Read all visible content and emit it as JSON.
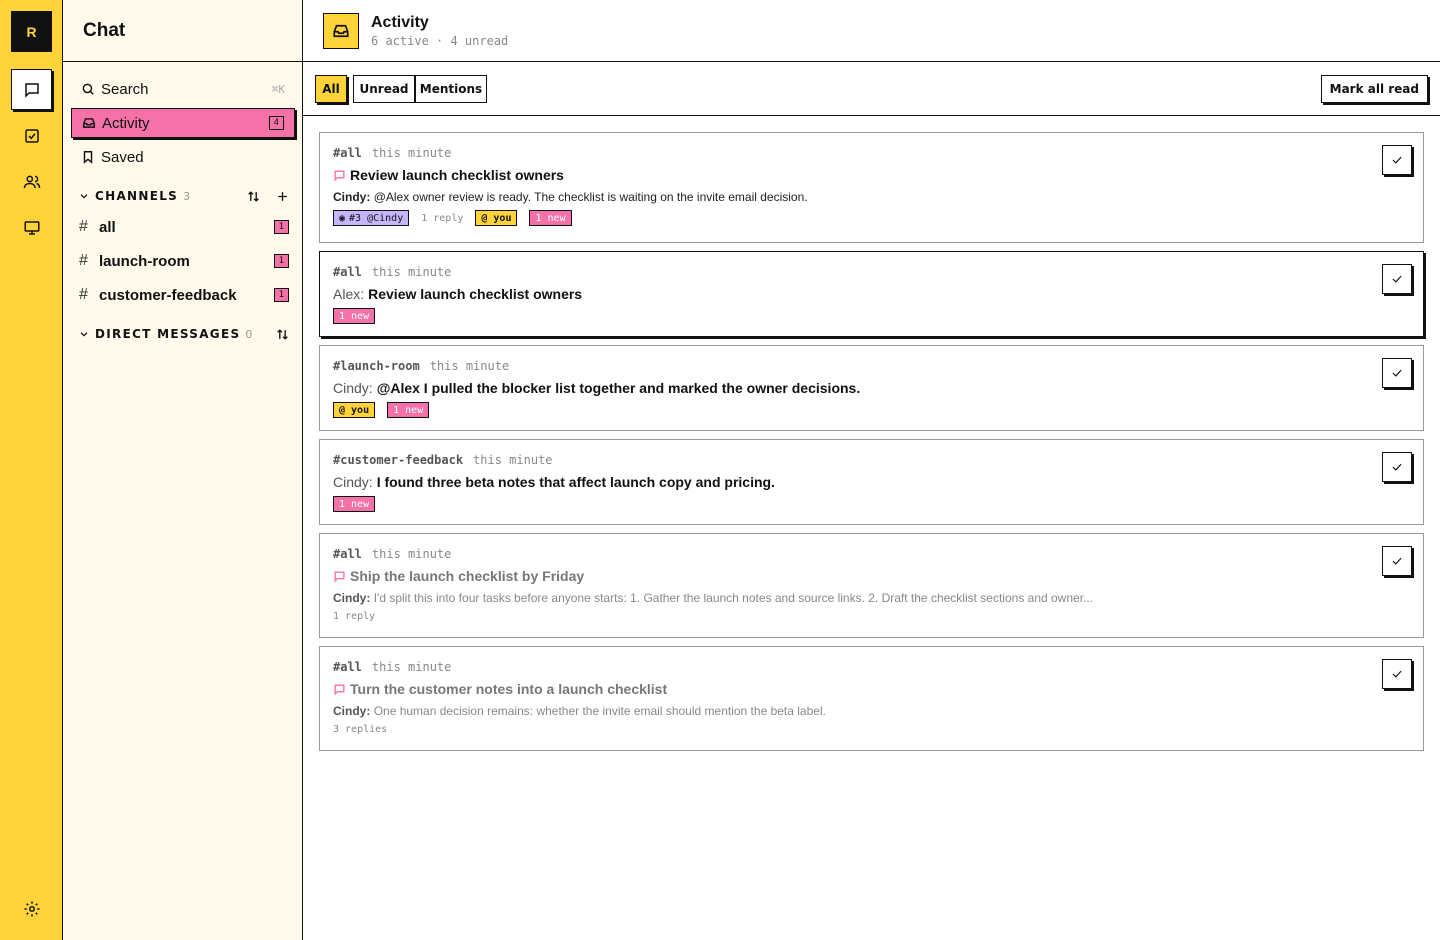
{
  "rail": {
    "logo": "R",
    "items": [
      {
        "icon": "chat-icon",
        "active": true
      },
      {
        "icon": "task-icon"
      },
      {
        "icon": "people-icon"
      },
      {
        "icon": "monitor-icon"
      }
    ],
    "settings_icon": "gear-icon"
  },
  "sidebar": {
    "title": "Chat",
    "search_label": "Search",
    "search_shortcut": "⌘K",
    "activity_label": "Activity",
    "activity_count": "4",
    "saved_label": "Saved",
    "channels_header": "CHANNELS",
    "channels_count": "3",
    "channels": [
      {
        "name": "all",
        "count": "1"
      },
      {
        "name": "launch-room",
        "count": "1"
      },
      {
        "name": "customer-feedback",
        "count": "1"
      }
    ],
    "dm_header": "DIRECT MESSAGES",
    "dm_count": "0"
  },
  "main": {
    "title": "Activity",
    "subtitle": "6 active · 4 unread",
    "filters": [
      "All",
      "Unread",
      "Mentions"
    ],
    "active_filter": "All",
    "mark_all_label": "Mark all read"
  },
  "items": [
    {
      "channel": "#all",
      "time": "this minute",
      "title": "Review launch checklist owners",
      "author": "",
      "body_author": "Cindy:",
      "body": "@Alex owner review is ready. The checklist is waiting on the invite email decision.",
      "tags": {
        "watch": "#3 @Cindy",
        "replies": "1 reply",
        "mention": "@ you",
        "new": "1 new"
      }
    },
    {
      "channel": "#all",
      "time": "this minute",
      "author": "Alex:",
      "title": "Review launch checklist owners",
      "tags": {
        "new": "1 new"
      }
    },
    {
      "channel": "#launch-room",
      "time": "this minute",
      "author": "Cindy:",
      "title": "@Alex I pulled the blocker list together and marked the owner decisions.",
      "tags": {
        "mention": "@ you",
        "new": "1 new"
      }
    },
    {
      "channel": "#customer-feedback",
      "time": "this minute",
      "author": "Cindy:",
      "title": "I found three beta notes that affect launch copy and pricing.",
      "tags": {
        "new": "1 new"
      }
    },
    {
      "channel": "#all",
      "time": "this minute",
      "title": "Ship the launch checklist by Friday",
      "body_author": "Cindy:",
      "body": "I'd split this into four tasks before anyone starts: 1. Gather the launch notes and source links. 2. Draft the checklist sections and owner...",
      "tags": {
        "replies": "1 reply"
      }
    },
    {
      "channel": "#all",
      "time": "this minute",
      "title": "Turn the customer notes into a launch checklist",
      "body_author": "Cindy:",
      "body": "One human decision remains: whether the invite email should mention the beta label.",
      "tags": {
        "replies": "3 replies"
      }
    }
  ],
  "colors": {
    "accent": "#ffd43b",
    "pink": "#f472a8",
    "purple": "#c4b5fd",
    "sidebar_bg": "#fffaeb"
  }
}
